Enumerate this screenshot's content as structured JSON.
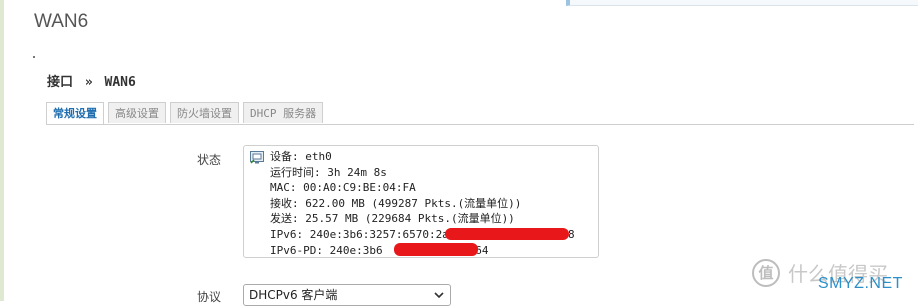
{
  "page": {
    "title": "WAN6"
  },
  "breadcrumb": {
    "parent": "接口",
    "separator": "»",
    "current": "WAN6"
  },
  "tabs": [
    {
      "label": "常规设置",
      "active": true
    },
    {
      "label": "高级设置",
      "active": false
    },
    {
      "label": "防火墙设置",
      "active": false
    },
    {
      "label": "DHCP 服务器",
      "active": false
    }
  ],
  "status": {
    "label": "状态",
    "icon": "network-port-icon",
    "lines": [
      "设备: eth0",
      "运行时间: 3h 24m 8s",
      "MAC: 00:A0:C9:BE:04:FA",
      "接收: 622.00 MB (499287 Pkts.(流量单位))",
      "发送: 25.57 MB (229684 Pkts.(流量单位))",
      "IPv6: 240e:3b6:3257:6570:2a0              /128",
      "IPv6-PD: 240e:3b6           ::/64"
    ]
  },
  "protocol": {
    "label": "协议",
    "selected": "DHCPv6 客户端"
  },
  "watermark": {
    "badge": "值",
    "text": "什么值得买",
    "brand": "SMYZ.NET"
  },
  "colors": {
    "active_tab": "#1f6fb0",
    "redaction": "#e8171a",
    "brand": "#2d8fc8"
  }
}
